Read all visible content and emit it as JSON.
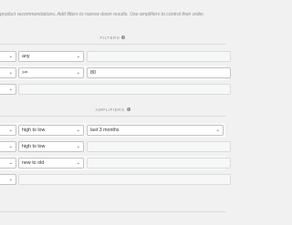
{
  "description": "product recommendations. Add filters to narrow down results. Use amplifiers to control their order.",
  "filters": {
    "title": "FILTERS",
    "help_icon": "question-circle-icon",
    "rows": [
      {
        "col1": "",
        "col2": "any",
        "col3": ""
      },
      {
        "col1": "",
        "col2": ">=",
        "col3": "80"
      },
      {
        "col1": "",
        "col3": ""
      }
    ]
  },
  "amplifiers": {
    "title": "AMPLIFIERS",
    "help_icon": "question-circle-icon",
    "rows": [
      {
        "col1": "",
        "col2": "high to low",
        "col3": "last 3 months"
      },
      {
        "col1": "",
        "col2": "high to low",
        "col3": ""
      },
      {
        "col1": "",
        "col2": "new to old",
        "col3": ""
      },
      {
        "col1": "",
        "col3": ""
      }
    ]
  },
  "icons": {
    "dropdown": "chevron-down-icon"
  }
}
